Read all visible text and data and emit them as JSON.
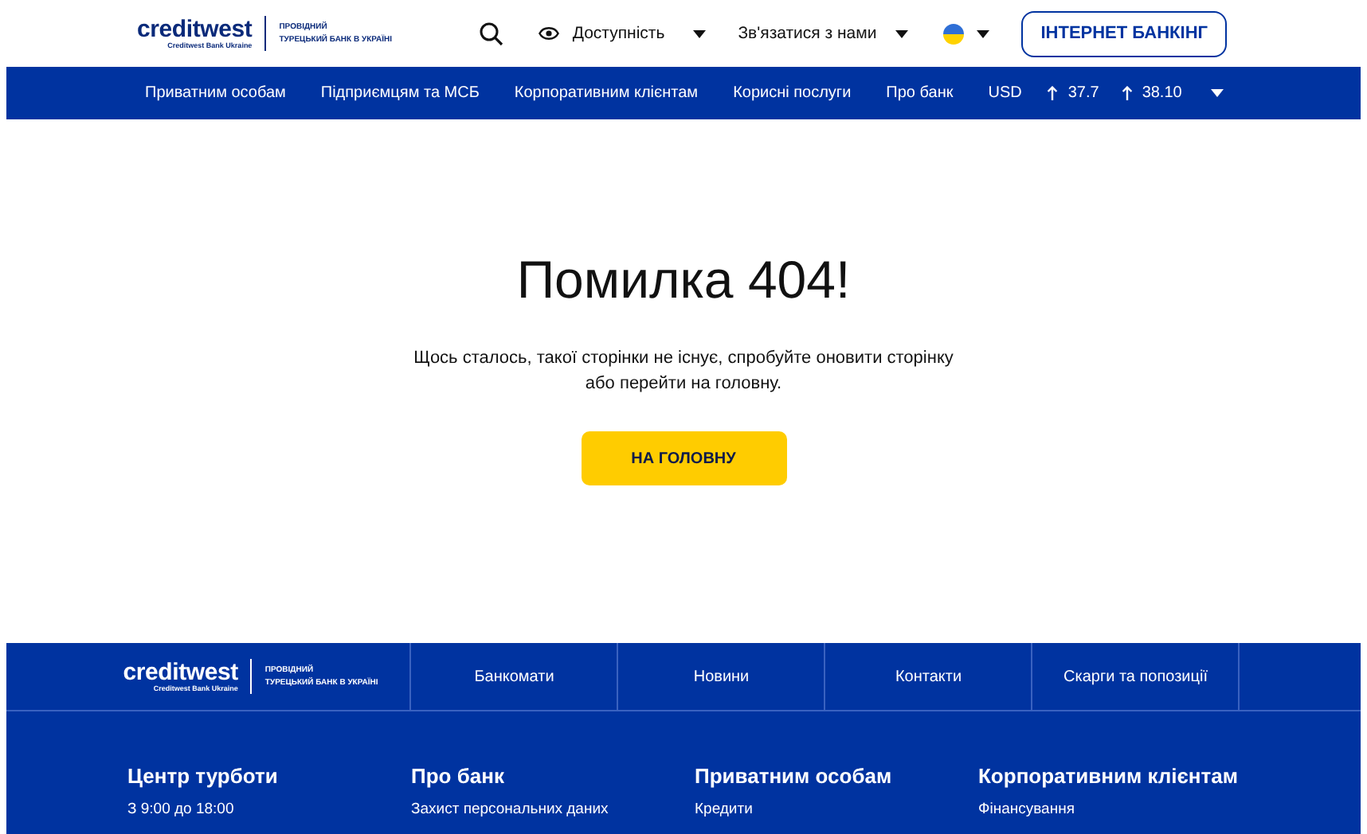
{
  "header": {
    "logo": {
      "name": "creditwest",
      "sub": "Creditwest Bank Ukraine",
      "tagline": [
        "ПРОВІДНИЙ",
        "ТУРЕЦЬКИЙ БАНК В УКРАЇНІ"
      ]
    },
    "accessibility": "Доступність",
    "contact": "Зв'язатися з нами",
    "banking_button": "ІНТЕРНЕТ БАНКІНГ"
  },
  "nav": {
    "items": [
      "Приватним особам",
      "Підприємцям та МСБ",
      "Корпоративним клієнтам",
      "Корисні послуги",
      "Про банк"
    ],
    "currency": {
      "code": "USD",
      "buy": "37.7",
      "sell": "38.10"
    }
  },
  "error": {
    "title": "Помилка 404!",
    "message": "Щось сталось, такої сторінки не існує, спробуйте оновити сторінку або перейти на головну.",
    "button": "НА ГОЛОВНУ"
  },
  "footer": {
    "logo": {
      "name": "creditwest",
      "sub": "Creditwest Bank Ukraine",
      "tagline": [
        "ПРОВІДНИЙ",
        "ТУРЕЦЬКИЙ БАНК В УКРАЇНІ"
      ]
    },
    "links": [
      "Банкомати",
      "Новини",
      "Контакти",
      "Скарги та попозиції"
    ],
    "columns": [
      {
        "title": "Центр турботи",
        "items": [
          "З 9:00 до 18:00"
        ]
      },
      {
        "title": "Про банк",
        "items": [
          "Захист персональних даних"
        ]
      },
      {
        "title": "Приватним особам",
        "items": [
          "Кредити"
        ]
      },
      {
        "title": "Корпоративним клієнтам",
        "items": [
          "Фінансування"
        ]
      }
    ]
  }
}
